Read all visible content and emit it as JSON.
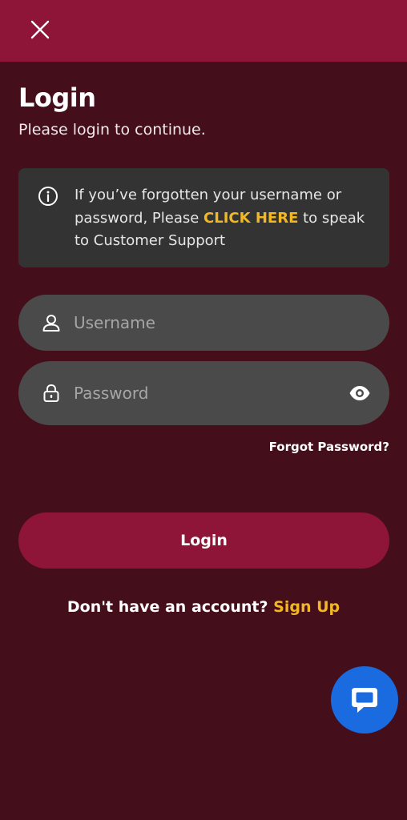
{
  "header": {
    "close_icon": "close-icon"
  },
  "page": {
    "title": "Login",
    "subtitle": "Please login to continue."
  },
  "info": {
    "icon": "info-icon",
    "text_before": "If you’ve forgotten your username or password, Please ",
    "link_text": "CLICK HERE",
    "text_after": " to speak to Customer Support"
  },
  "form": {
    "username": {
      "placeholder": "Username",
      "value": "",
      "icon": "user-icon"
    },
    "password": {
      "placeholder": "Password",
      "value": "",
      "icon": "lock-icon",
      "toggle_icon": "eye-icon"
    },
    "forgot_label": "Forgot Password?",
    "login_label": "Login"
  },
  "signup": {
    "prompt": "Don't have an account?",
    "link": "Sign Up"
  },
  "chat": {
    "icon": "chat-bubble-icon"
  },
  "colors": {
    "background": "#450e1b",
    "brand": "#8e1538",
    "accent_yellow": "#f2b822",
    "field": "#4a4a4a",
    "info_box": "#333333",
    "chat_button": "#1a6ae0"
  }
}
